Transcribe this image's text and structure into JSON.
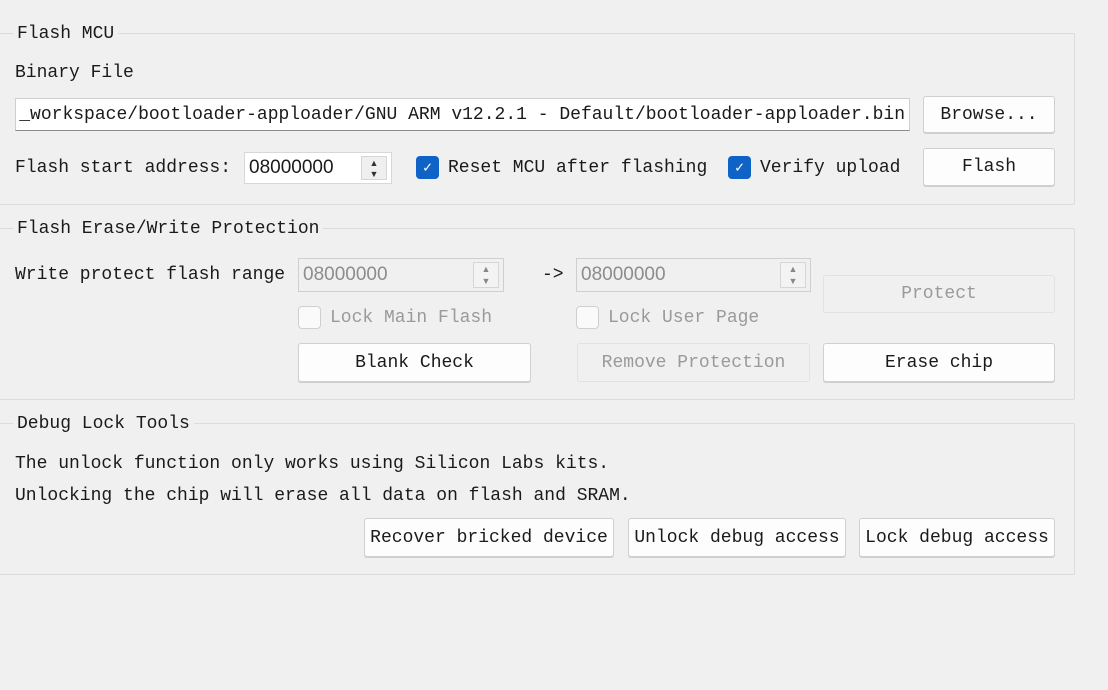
{
  "flash_mcu": {
    "title": "Flash MCU",
    "binary_file_label": "Binary File",
    "binary_file_path": "_workspace/bootloader-apploader/GNU ARM v12.2.1 - Default/bootloader-apploader.bin",
    "browse_label": "Browse...",
    "start_address_label": "Flash start address:",
    "start_address_value": "08000000",
    "reset_mcu_label": "Reset MCU after flashing",
    "reset_mcu_checked": true,
    "verify_label": "Verify upload",
    "verify_checked": true,
    "flash_label": "Flash"
  },
  "protection": {
    "title": "Flash Erase/Write Protection",
    "range_label": "Write protect flash range",
    "range_start": "08000000",
    "arrow": "->",
    "range_end": "08000000",
    "protect_label": "Protect",
    "lock_main_label": "Lock Main Flash",
    "lock_main_checked": false,
    "lock_user_label": "Lock User Page",
    "lock_user_checked": false,
    "blank_check_label": "Blank Check",
    "remove_protection_label": "Remove Protection",
    "erase_chip_label": "Erase chip"
  },
  "debug_lock": {
    "title": "Debug Lock Tools",
    "info_line1": "The unlock function only works using Silicon Labs kits.",
    "info_line2": "Unlocking the chip will erase all data on flash and SRAM.",
    "recover_label": "Recover bricked device",
    "unlock_label": "Unlock debug access",
    "lock_label": "Lock debug access"
  },
  "colors": {
    "accent": "#0f62c6",
    "background": "#f0f0f0"
  }
}
